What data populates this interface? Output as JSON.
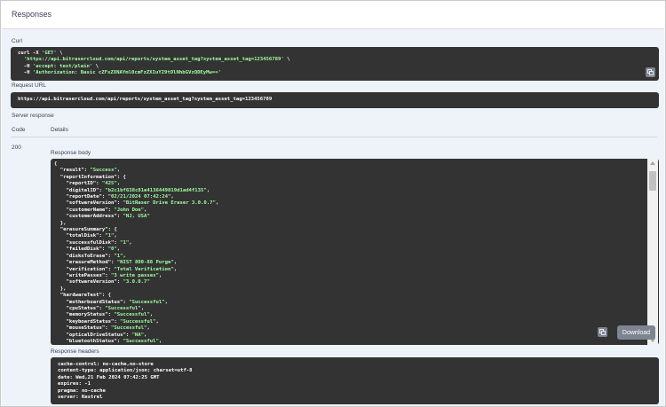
{
  "header": {
    "title": "Responses"
  },
  "curl": {
    "label": "Curl",
    "lines": [
      "curl -X 'GET' \\",
      "  'https://api.bitrasercloud.com/api/reports/system_asset_tag?system_asset_tag=123456789' \\",
      "  -H 'accept: text/plain' \\",
      "  -H 'Authorization: Basic cZFsZXNAYml0cmFzZXIuY29tOlNhbGVzQDEyMw=='"
    ]
  },
  "request_url": {
    "label": "Request URL",
    "value": "https://api.bitrasercloud.com/api/reports/system_asset_tag?system_asset_tag=123456789"
  },
  "server_response": {
    "label": "Server response",
    "col_code": "Code",
    "col_details": "Details",
    "code": "200",
    "body_label": "Response body",
    "body_lines": [
      "{",
      "  \"result\": \"Success\",",
      "  \"reportInformation\": {",
      "    \"reportID\": \"425\",",
      "    \"digitalID\": \"b2c1bf638c81e4136449819d1ad4f135\",",
      "    \"reportDate\": \"02/21/2024 07:42:24\",",
      "    \"softwareVersion\": \"BitRaser Drive Eraser 3.0.0.7\",",
      "    \"customerName\": \"John Doe\",",
      "    \"customerAddress\": \"NJ, USA\"",
      "  },",
      "  \"erasureSummary\": {",
      "    \"totalDisk\": \"1\",",
      "    \"successfulDisk\": \"1\",",
      "    \"failedDisk\": \"0\",",
      "    \"disksToErase\": \"1\",",
      "    \"erasureMethod\": \"NIST 800-88 Purge\",",
      "    \"verification\": \"Total Verification\",",
      "    \"writePasses\": \"3 write passes\",",
      "    \"softwareVersion\": \"3.0.0.7\"",
      "  },",
      "  \"hardwareTest\": {",
      "    \"motherboardStatus\": \"Successful\",",
      "    \"cpuStatus\": \"Successful\",",
      "    \"memoryStatus\": \"Successful\",",
      "    \"keyboardStatus\": \"Successful\",",
      "    \"mouseStatus\": \"Successful\",",
      "    \"opticalDriveStatus\": \"NA\",",
      "    \"bluetoothStatus\": \"Successful\",",
      "    \"wifiStatus\": \"Successful\","
    ],
    "download_label": "Download",
    "headers_label": "Response headers",
    "headers_lines": [
      "cache-control: no-cache,no-store",
      "content-type: application/json; charset=utf-8",
      "date: Wed,21 Feb 2024 07:42:25 GMT",
      "expires: -1",
      "pragma: no-cache",
      "server: Kestrel"
    ]
  },
  "icons": {
    "copy": "copy-icon"
  }
}
